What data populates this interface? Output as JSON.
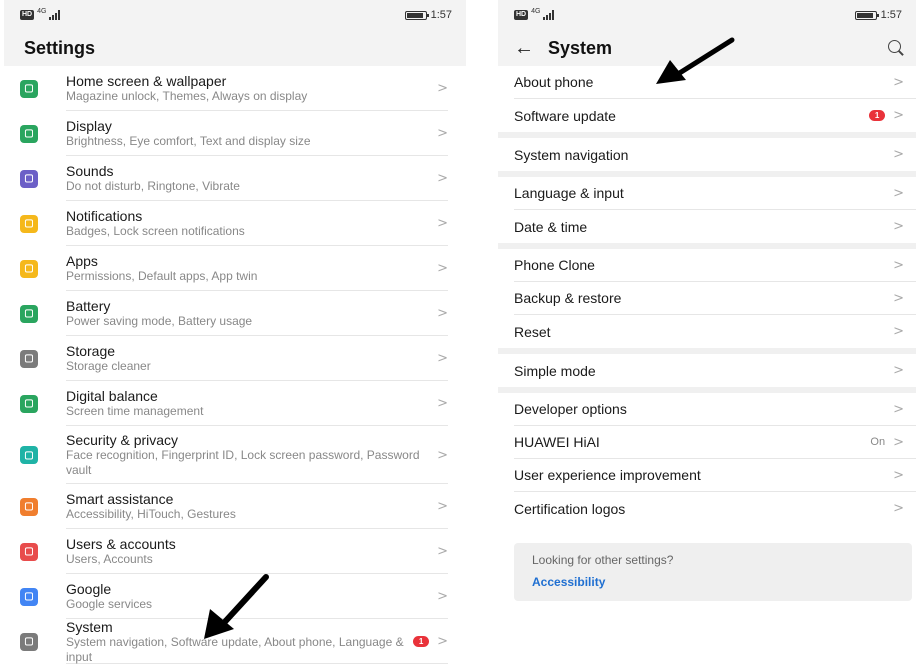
{
  "left": {
    "status": {
      "hd": "HD",
      "network": "4G",
      "time": "1:57"
    },
    "title": "Settings",
    "items": [
      {
        "title": "Home screen & wallpaper",
        "subtitle": "Magazine unlock, Themes, Always on display",
        "icon": "home-screen-icon",
        "color": "#2aa55f"
      },
      {
        "title": "Display",
        "subtitle": "Brightness, Eye comfort, Text and display size",
        "icon": "display-icon",
        "color": "#2aa55f"
      },
      {
        "title": "Sounds",
        "subtitle": "Do not disturb, Ringtone, Vibrate",
        "icon": "sound-icon",
        "color": "#6c5fc7"
      },
      {
        "title": "Notifications",
        "subtitle": "Badges, Lock screen notifications",
        "icon": "bell-icon",
        "color": "#f5b81b"
      },
      {
        "title": "Apps",
        "subtitle": "Permissions, Default apps, App twin",
        "icon": "apps-icon",
        "color": "#f5b81b"
      },
      {
        "title": "Battery",
        "subtitle": "Power saving mode, Battery usage",
        "icon": "battery-icon",
        "color": "#2aa55f"
      },
      {
        "title": "Storage",
        "subtitle": "Storage cleaner",
        "icon": "storage-icon",
        "color": "#7b7b7b"
      },
      {
        "title": "Digital balance",
        "subtitle": "Screen time management",
        "icon": "hourglass-icon",
        "color": "#2aa55f"
      },
      {
        "title": "Security & privacy",
        "subtitle": "Face recognition, Fingerprint ID, Lock screen password, Password vault",
        "icon": "shield-icon",
        "color": "#1fb3a6"
      },
      {
        "title": "Smart assistance",
        "subtitle": "Accessibility, HiTouch, Gestures",
        "icon": "hand-icon",
        "color": "#f07e2e"
      },
      {
        "title": "Users & accounts",
        "subtitle": "Users, Accounts",
        "icon": "user-icon",
        "color": "#e84c4c"
      },
      {
        "title": "Google",
        "subtitle": "Google services",
        "icon": "google-icon",
        "color": "#4285f4"
      },
      {
        "title": "System",
        "subtitle": "System navigation, Software update, About phone, Language & input",
        "icon": "system-icon",
        "color": "#7b7b7b",
        "badge": "1"
      }
    ]
  },
  "right": {
    "status": {
      "hd": "HD",
      "network": "4G",
      "time": "1:57"
    },
    "title": "System",
    "groups": [
      [
        {
          "label": "About phone"
        },
        {
          "label": "Software update",
          "badge": "1"
        }
      ],
      [
        {
          "label": "System navigation"
        }
      ],
      [
        {
          "label": "Language & input"
        },
        {
          "label": "Date & time"
        }
      ],
      [
        {
          "label": "Phone Clone"
        },
        {
          "label": "Backup & restore"
        },
        {
          "label": "Reset"
        }
      ],
      [
        {
          "label": "Simple mode"
        }
      ],
      [
        {
          "label": "Developer options"
        },
        {
          "label": "HUAWEI HiAI",
          "value": "On"
        },
        {
          "label": "User experience improvement"
        },
        {
          "label": "Certification logos"
        }
      ]
    ],
    "footer": {
      "question": "Looking for other settings?",
      "link": "Accessibility"
    }
  },
  "chevron": ">"
}
